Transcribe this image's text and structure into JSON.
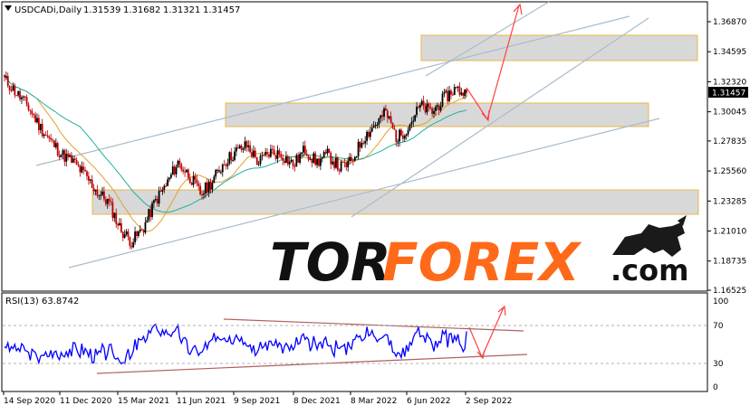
{
  "header": {
    "symbol_tf": "USDCADi,Daily",
    "open": "1.31539",
    "high": "1.31682",
    "low": "1.31321",
    "close": "1.31457"
  },
  "price_axis": {
    "ticks": [
      "1.36870",
      "1.34595",
      "1.32320",
      "1.30045",
      "1.27835",
      "1.25560",
      "1.23285",
      "1.21010",
      "1.18735",
      "1.16525"
    ],
    "current_price_label": "1.31457"
  },
  "rsi": {
    "label": "RSI(13) 63.8742",
    "ticks": [
      "100",
      "70",
      "30",
      "0"
    ]
  },
  "time_axis": {
    "ticks": [
      "14 Sep 2020",
      "11 Dec 2020",
      "15 Mar 2021",
      "11 Jun 2021",
      "9 Sep 2021",
      "8 Dec 2021",
      "8 Mar 2022",
      "6 Jun 2022",
      "2 Sep 2022"
    ]
  },
  "logo": {
    "part1": "TOR",
    "part2": "FOREX",
    "part3": ".com"
  },
  "colors": {
    "bull_candle": "#000000",
    "bear_candle": "#c00000",
    "ma_fast": "#e0a030",
    "ma_slow": "#20b0a0",
    "rsi_line": "#0000ff",
    "zone_fill": "#d8d8d8",
    "zone_border": "#e8b84a",
    "channel": "#a8bccc",
    "arrow": "#ff4040",
    "rsi_trend": "#b06060"
  },
  "chart_data": [
    {
      "type": "candlestick",
      "title": "USDCADi,Daily",
      "ylim": [
        1.16525,
        1.38
      ],
      "last_close": 1.31457,
      "x": [
        "14 Sep 2020",
        "11 Dec 2020",
        "15 Mar 2021",
        "11 Jun 2021",
        "9 Sep 2021",
        "8 Dec 2021",
        "8 Mar 2022",
        "6 Jun 2022",
        "2 Sep 2022"
      ],
      "close_path": [
        1.325,
        1.315,
        1.305,
        1.29,
        1.278,
        1.268,
        1.262,
        1.252,
        1.24,
        1.232,
        1.212,
        1.202,
        1.212,
        1.232,
        1.245,
        1.262,
        1.252,
        1.238,
        1.248,
        1.262,
        1.27,
        1.275,
        1.262,
        1.27,
        1.268,
        1.26,
        1.272,
        1.262,
        1.268,
        1.258,
        1.262,
        1.28,
        1.29,
        1.3,
        1.28,
        1.29,
        1.305,
        1.3,
        1.31,
        1.318,
        1.314
      ],
      "zones": [
        [
          1.3432,
          1.359
        ],
        [
          1.2895,
          1.305
        ],
        [
          1.2235,
          1.2385
        ]
      ]
    },
    {
      "type": "line",
      "title": "RSI(13) 63.8742",
      "ylim": [
        0,
        100
      ],
      "levels": [
        70,
        30
      ],
      "last_value": 63.8742
    }
  ]
}
